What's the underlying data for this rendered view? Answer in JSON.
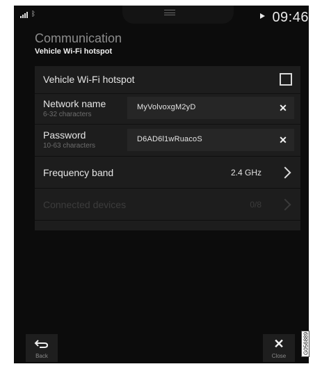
{
  "status_bar": {
    "signal_icon": "signal-bars-icon",
    "bluetooth_icon": "bluetooth-icon",
    "bluetooth_glyph": "ᛒ",
    "media_icon": "play-icon",
    "time": "09:46"
  },
  "header": {
    "title": "Communication",
    "subtitle": "Vehicle Wi-Fi hotspot"
  },
  "settings": {
    "hotspot": {
      "label": "Vehicle Wi-Fi hotspot",
      "checked": false
    },
    "network_name": {
      "label": "Network name",
      "hint": "6-32 characters",
      "value": "MyVolvoxgM2yD",
      "clear_glyph": "✕"
    },
    "password": {
      "label": "Password",
      "hint": "10-63 characters",
      "value": "D6AD6l1wRuacoS",
      "clear_glyph": "✕"
    },
    "frequency_band": {
      "label": "Frequency band",
      "value": "2.4 GHz"
    },
    "connected_devices": {
      "label": "Connected devices",
      "value": "0/8",
      "enabled": false
    }
  },
  "footer": {
    "back_label": "Back",
    "close_label": "Close",
    "close_glyph": "✕"
  },
  "image_code": "G056889",
  "colors": {
    "background": "#0c0c0c",
    "panel": "#1d1d1d",
    "field": "#262626",
    "text_primary": "#e6e6e6",
    "text_muted": "#6d6d6d"
  }
}
